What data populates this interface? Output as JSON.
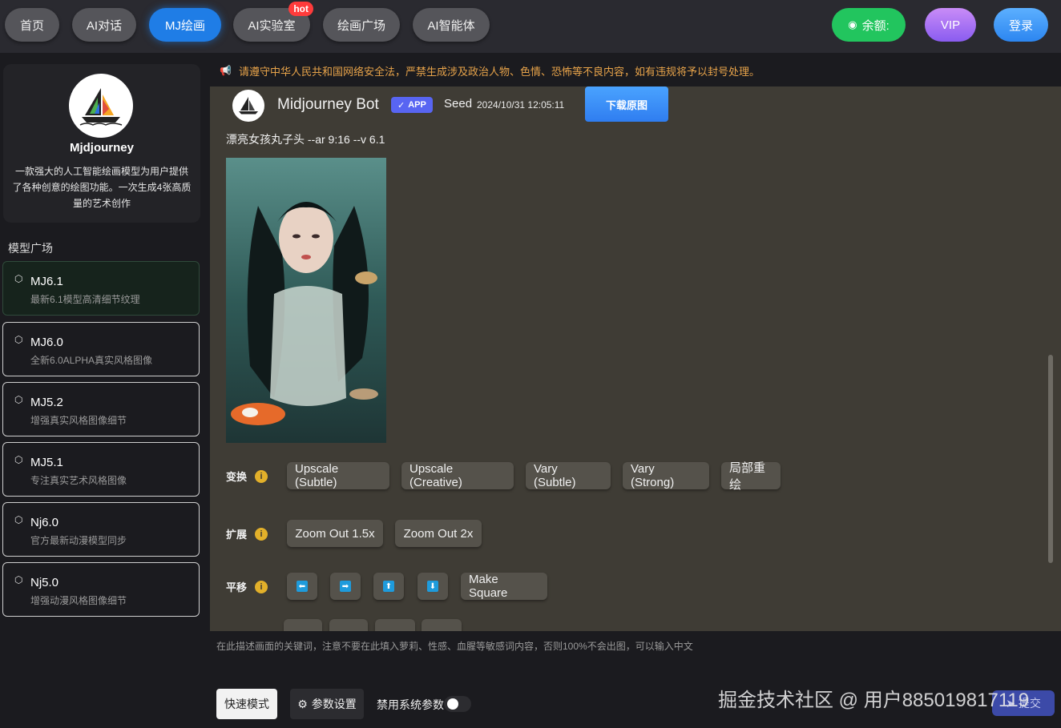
{
  "nav": {
    "tabs": [
      {
        "label": "首页"
      },
      {
        "label": "AI对话"
      },
      {
        "label": "MJ绘画"
      },
      {
        "label": "AI实验室"
      },
      {
        "label": "绘画广场"
      },
      {
        "label": "AI智能体"
      }
    ],
    "hot_badge": "hot",
    "balance_label": "余额:",
    "vip_label": "VIP",
    "login_label": "登录",
    "accent": "#1f7de6"
  },
  "sidebar": {
    "name": "Mjdjourney",
    "description": "一款强大的人工智能绘画模型为用户提供了各种创意的绘图功能。一次生成4张高质量的艺术创作",
    "section_title": "模型广场",
    "models": [
      {
        "name": "MJ6.1",
        "desc": "最新6.1模型高清细节纹理",
        "active": true
      },
      {
        "name": "MJ6.0",
        "desc": "全新6.0ALPHA真实风格图像"
      },
      {
        "name": "MJ5.2",
        "desc": "增强真实风格图像细节"
      },
      {
        "name": "MJ5.1",
        "desc": "专注真实艺术风格图像"
      },
      {
        "name": "Nj6.0",
        "desc": "官方最新动漫模型同步"
      },
      {
        "name": "Nj5.0",
        "desc": "增强动漫风格图像细节"
      }
    ]
  },
  "notice": "请遵守中华人民共和国网络安全法，严禁生成涉及政治人物、色情、恐怖等不良内容，如有违规将予以封号处理。",
  "message": {
    "bot_name": "Midjourney Bot",
    "app_badge": "APP",
    "seed_label": "Seed",
    "timestamp": "2024/10/31 12:05:11",
    "download_label": "下载原图",
    "prompt": "漂亮女孩丸子头 --ar 9:16 --v 6.1"
  },
  "actions": {
    "transform_label": "变换",
    "transform_buttons": [
      "Upscale (Subtle)",
      "Upscale (Creative)",
      "Vary (Subtle)",
      "Vary (Strong)",
      "局部重绘"
    ],
    "extend_label": "扩展",
    "extend_buttons": [
      "Zoom Out 1.5x",
      "Zoom Out 2x"
    ],
    "pan_label": "平移",
    "pan_arrows": [
      "left-arrow-icon",
      "right-arrow-icon",
      "up-arrow-icon",
      "down-arrow-icon"
    ],
    "make_square_label": "Make Square"
  },
  "input": {
    "placeholder": "在此描述画面的关键词，注意不要在此填入萝莉、性感、血腥等敏感词内容，否则100%不会出图，可以输入中文",
    "fast_mode_label": "快速模式",
    "params_label": "参数设置",
    "disable_params_label": "禁用系统参数",
    "submit_label": "提交"
  },
  "watermark": "掘金技术社区 @ 用户885019817119"
}
